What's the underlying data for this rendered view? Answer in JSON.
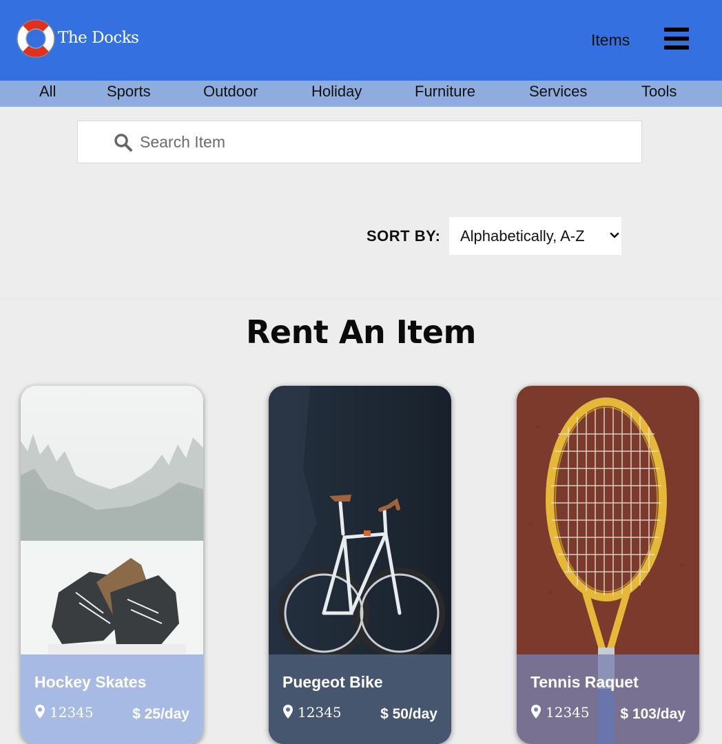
{
  "header": {
    "brand": "The Docks",
    "items_link": "Items",
    "menu_icon": "hamburger-menu-icon",
    "logo_icon": "lifebuoy-logo",
    "brand_color": "#3570e0"
  },
  "categories": [
    "All",
    "Sports",
    "Outdoor",
    "Holiday",
    "Furniture",
    "Services",
    "Tools"
  ],
  "search": {
    "placeholder": "Search Item",
    "value": "",
    "icon": "search-icon"
  },
  "sort": {
    "label": "SORT BY:",
    "selected": "Alphabetically, A-Z"
  },
  "main": {
    "title": "Rent An Item"
  },
  "items": [
    {
      "name": "Hockey Skates",
      "location": "12345",
      "price": "$ 25/day",
      "image": "hockey-skates-in-snow"
    },
    {
      "name": "Puegeot Bike",
      "location": "12345",
      "price": "$ 50/day",
      "image": "road-bike-dark-wall"
    },
    {
      "name": "Tennis Raquet",
      "location": "12345",
      "price": "$ 103/day",
      "image": "tennis-racket-on-clay"
    }
  ]
}
